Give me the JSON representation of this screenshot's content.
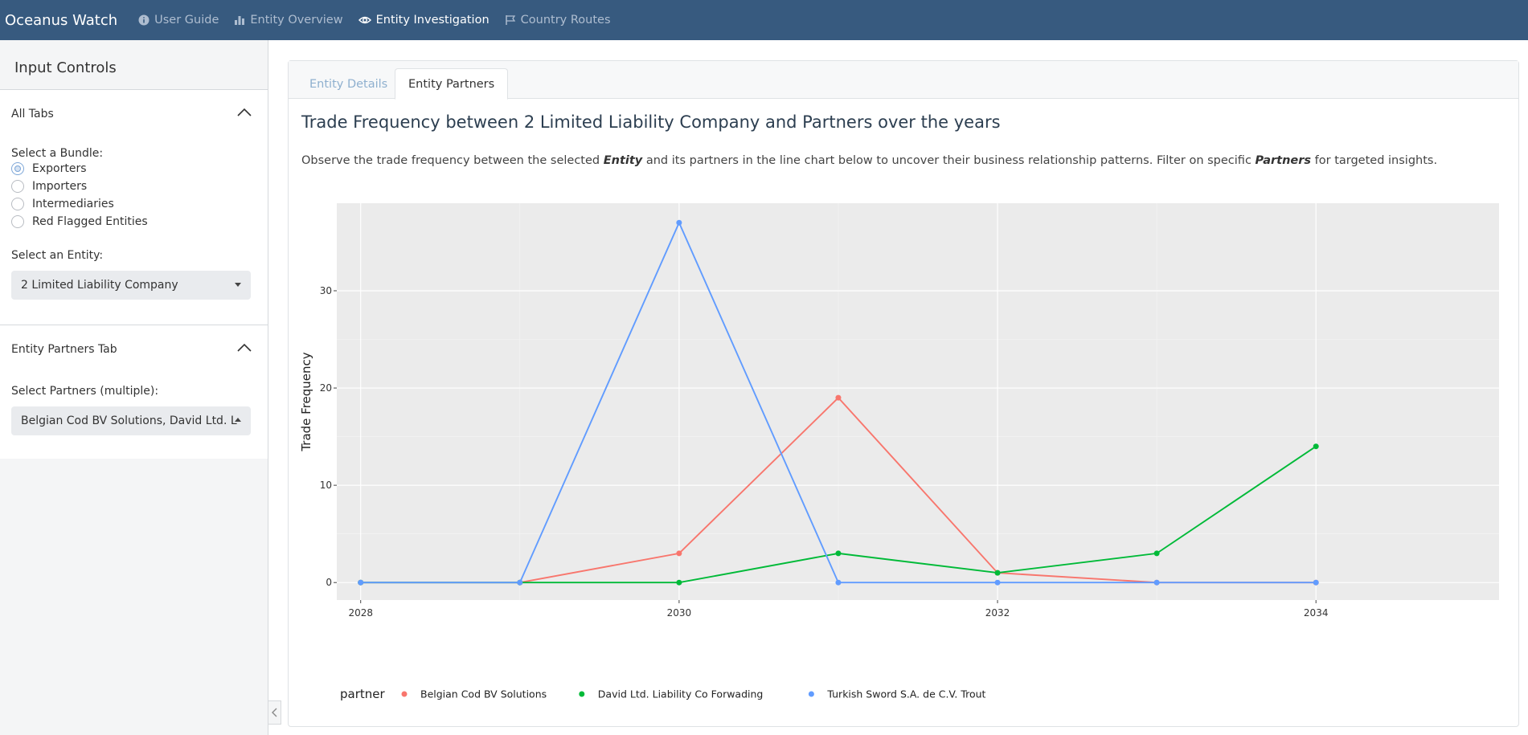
{
  "navbar": {
    "brand": "Oceanus Watch",
    "items": [
      {
        "label": "User Guide",
        "icon": "info-circle-icon",
        "active": false
      },
      {
        "label": "Entity Overview",
        "icon": "bar-chart-icon",
        "active": false
      },
      {
        "label": "Entity Investigation",
        "icon": "eye-icon",
        "active": true
      },
      {
        "label": "Country Routes",
        "icon": "flag-icon",
        "active": false
      }
    ]
  },
  "sidebar": {
    "title": "Input Controls",
    "panel1": {
      "header": "All Tabs",
      "bundle_label": "Select a Bundle:",
      "bundles": [
        "Exporters",
        "Importers",
        "Intermediaries",
        "Red Flagged Entities"
      ],
      "selected_bundle": "Exporters",
      "entity_label": "Select an Entity:",
      "entity_value": "2 Limited Liability Company"
    },
    "panel2": {
      "header": "Entity Partners Tab",
      "partners_label": "Select Partners (multiple):",
      "partners_value": "Belgian Cod BV Solutions, David Ltd. L"
    }
  },
  "main": {
    "tabs": [
      {
        "label": "Entity Details",
        "active": false
      },
      {
        "label": "Entity Partners",
        "active": true
      }
    ],
    "title": "Trade Frequency between 2 Limited Liability Company and Partners over the years",
    "desc_part1": "Observe the trade frequency between the selected ",
    "desc_bold1": "Entity",
    "desc_part2": " and its partners in the line chart below to uncover their business relationship patterns. Filter on specific ",
    "desc_bold2": "Partners",
    "desc_part3": " for targeted insights."
  },
  "chart_data": {
    "type": "line",
    "xlabel": "",
    "ylabel": "Trade Frequency",
    "x": [
      2028,
      2029,
      2030,
      2031,
      2032,
      2033,
      2034
    ],
    "xticks": [
      2028,
      2030,
      2032,
      2034
    ],
    "yticks": [
      0,
      10,
      20,
      30
    ],
    "xlim": [
      2027.85,
      2035.15
    ],
    "ylim": [
      -1.8,
      39
    ],
    "grid": true,
    "legend_title": "partner",
    "legend_position": "bottom",
    "series": [
      {
        "name": "Belgian Cod BV Solutions",
        "color": "#f8766d",
        "values": [
          0,
          0,
          3,
          19,
          1,
          0,
          0
        ]
      },
      {
        "name": "David Ltd. Liability Co Forwading",
        "color": "#00ba38",
        "values": [
          0,
          0,
          0,
          3,
          1,
          3,
          14
        ]
      },
      {
        "name": "Turkish Sword S.A. de C.V. Trout",
        "color": "#619cff",
        "values": [
          0,
          0,
          37,
          0,
          0,
          0,
          0
        ]
      }
    ]
  }
}
